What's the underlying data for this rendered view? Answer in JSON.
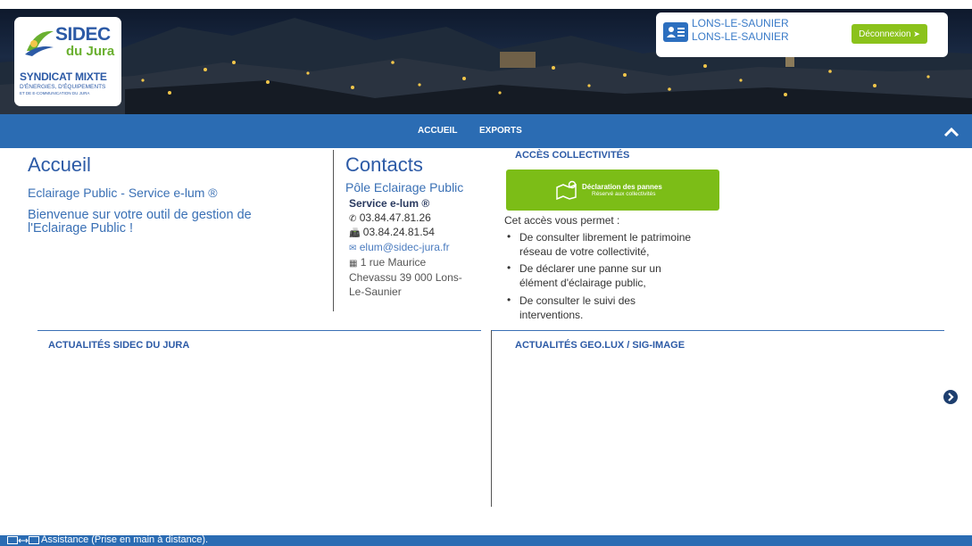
{
  "header": {
    "logo": {
      "brand": "SIDEC",
      "brand_sub": "du Jura",
      "line1": "SYNDICAT MIXTE",
      "line2": "D'ÉNERGIES, D'ÉQUIPEMENTS",
      "line3": "ET DE E-COMMUNICATION DU JURA"
    },
    "user": {
      "line1": "LONS-LE-SAUNIER",
      "line2": "LONS-LE-SAUNIER",
      "logout_label": "Déconnexion",
      "icon": "id-card-icon"
    }
  },
  "nav": {
    "items": [
      {
        "label": "ACCUEIL"
      },
      {
        "label": "EXPORTS"
      }
    ],
    "collapse_icon": "chevron-up-icon"
  },
  "accueil": {
    "title": "Accueil",
    "subtitle": "Eclairage Public - Service e-lum ®",
    "welcome": "Bienvenue sur votre outil de gestion de l'Eclairage Public !"
  },
  "contacts": {
    "title": "Contacts",
    "pole": "Pôle Eclairage Public",
    "service": "Service e-lum ®",
    "phone": "03.84.47.81.26",
    "fax": "03.84.24.81.54",
    "email": "elum@sidec-jura.fr",
    "address_line1": "1 rue Maurice",
    "address_line2": "Chevassu 39 000 Lons-",
    "address_line3": "Le-Saunier"
  },
  "acces": {
    "title": "ACCÈS COLLECTIVITÉS",
    "button_title": "Déclaration des pannes",
    "button_sub": "Réservé aux collectivités",
    "intro": "Cet accès vous permet :",
    "bullets": [
      {
        "line1": "De consulter librement le patrimoine",
        "line2": "réseau de votre collectivité,"
      },
      {
        "line1": "De déclarer une panne sur un",
        "line2": "élément d'éclairage public,"
      },
      {
        "line1": "De consulter le suivi des",
        "line2": "interventions."
      }
    ]
  },
  "news": {
    "sidec_title": "ACTUALITÉS SIDEC DU JURA",
    "geolux_title": "ACTUALITÉS GEO.LUX / SIG-IMAGE"
  },
  "footer": {
    "assistance": "Assistance (Prise en main à distance)."
  },
  "colors": {
    "nav_blue": "#2b6cb3",
    "title_blue": "#2c5aa6",
    "green": "#7cbd17"
  }
}
